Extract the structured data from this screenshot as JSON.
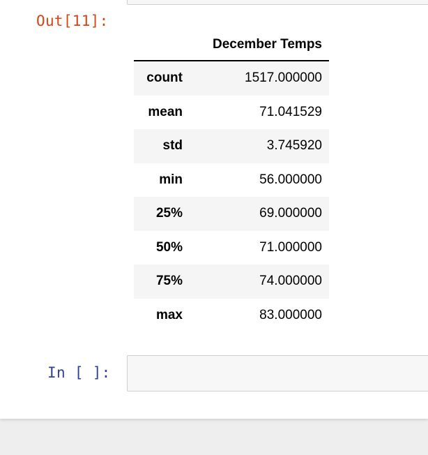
{
  "output_cell": {
    "prompt": "Out[11]:",
    "table": {
      "column_header": "December Temps",
      "rows": [
        {
          "label": "count",
          "value": "1517.000000"
        },
        {
          "label": "mean",
          "value": "71.041529"
        },
        {
          "label": "std",
          "value": "3.745920"
        },
        {
          "label": "min",
          "value": "56.000000"
        },
        {
          "label": "25%",
          "value": "69.000000"
        },
        {
          "label": "50%",
          "value": "71.000000"
        },
        {
          "label": "75%",
          "value": "74.000000"
        },
        {
          "label": "max",
          "value": "83.000000"
        }
      ]
    }
  },
  "input_cell": {
    "prompt": "In [ ]:",
    "code": ""
  },
  "colors": {
    "out_prompt": "#d84315",
    "in_prompt": "#303f9f",
    "striped_row": "#f5f5f5"
  }
}
